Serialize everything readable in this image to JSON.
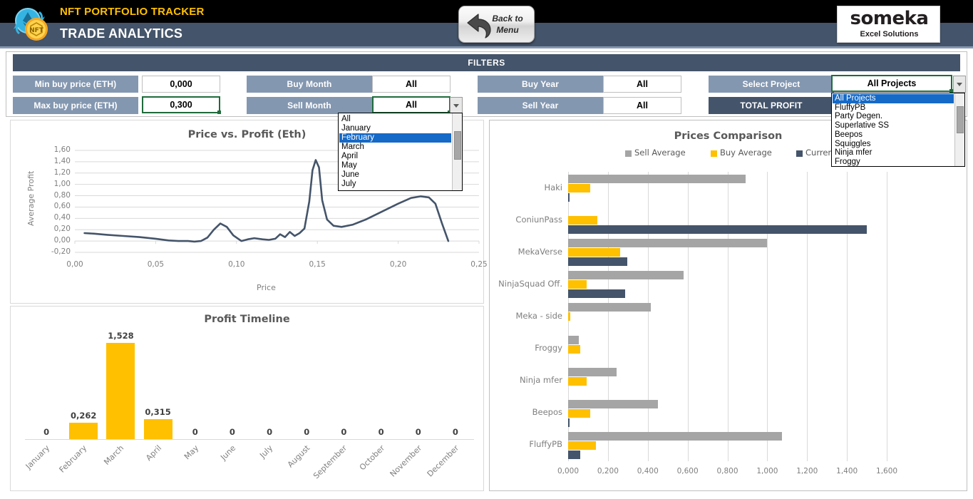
{
  "header": {
    "app_title": "NFT PORTFOLIO TRACKER",
    "page_title": "TRADE ANALYTICS",
    "back_button_line1": "Back to",
    "back_button_line2": "Menu",
    "brand_name": "someka",
    "brand_tagline": "Excel Solutions",
    "colors": {
      "top_bar": "#000000",
      "title_bar": "#44546a",
      "accent_yellow": "#ffc000"
    }
  },
  "filters": {
    "title": "FILTERS",
    "min_buy_price": {
      "label": "Min buy price (ETH)",
      "value": "0,000"
    },
    "max_buy_price": {
      "label": "Max buy price (ETH)",
      "value": "0,300"
    },
    "buy_month": {
      "label": "Buy Month",
      "value": "All"
    },
    "sell_month": {
      "label": "Sell Month",
      "value": "All"
    },
    "buy_year": {
      "label": "Buy Year",
      "value": "All"
    },
    "sell_year": {
      "label": "Sell Year",
      "value": "All"
    },
    "select_project": {
      "label": "Select Project",
      "value": "All Projects"
    },
    "total_profit": {
      "label": "TOTAL PROFIT"
    },
    "month_dropdown": {
      "open": true,
      "selected": "February",
      "options": [
        "All",
        "January",
        "February",
        "March",
        "April",
        "May",
        "June",
        "July"
      ]
    },
    "project_dropdown": {
      "open": true,
      "selected": "All Projects",
      "options": [
        "All Projects",
        "FluffyPB",
        "Party Degen.",
        "Superlative SS",
        "Beepos",
        "Squiggles",
        "Ninja mfer",
        "Froggy"
      ]
    }
  },
  "chart_data": [
    {
      "type": "line",
      "title": "Price vs. Profit (Eth)",
      "xlabel": "Price",
      "ylabel": "Average Profit",
      "xlim": [
        0.0,
        0.25
      ],
      "ylim": [
        -0.2,
        1.6
      ],
      "xticks": [
        "0,00",
        "0,05",
        "0,10",
        "0,15",
        "0,20",
        "0,25"
      ],
      "yticks": [
        "-0,20",
        "0,00",
        "0,20",
        "0,40",
        "0,60",
        "0,80",
        "1,00",
        "1,20",
        "1,40",
        "1,60"
      ],
      "grid": true,
      "legend": "none",
      "series": [
        {
          "name": "Average Profit",
          "color": "#44546a",
          "x": [
            0.006,
            0.012,
            0.02,
            0.03,
            0.04,
            0.05,
            0.058,
            0.064,
            0.07,
            0.074,
            0.078,
            0.082,
            0.086,
            0.09,
            0.094,
            0.098,
            0.103,
            0.107,
            0.111,
            0.116,
            0.12,
            0.124,
            0.127,
            0.13,
            0.133,
            0.136,
            0.139,
            0.142,
            0.145,
            0.147,
            0.149,
            0.151,
            0.153,
            0.156,
            0.16,
            0.165,
            0.172,
            0.18,
            0.19,
            0.2,
            0.208,
            0.214,
            0.219,
            0.223,
            0.227,
            0.231
          ],
          "y": [
            0.14,
            0.13,
            0.11,
            0.09,
            0.07,
            0.04,
            0.01,
            0.0,
            0.0,
            -0.01,
            0.0,
            0.06,
            0.2,
            0.31,
            0.25,
            0.1,
            0.0,
            0.03,
            0.05,
            0.03,
            0.02,
            0.04,
            0.12,
            0.07,
            0.16,
            0.09,
            0.14,
            0.22,
            0.7,
            1.25,
            1.43,
            1.3,
            0.72,
            0.38,
            0.27,
            0.25,
            0.29,
            0.38,
            0.52,
            0.66,
            0.76,
            0.79,
            0.77,
            0.66,
            0.32,
            0.0
          ]
        }
      ]
    },
    {
      "type": "bar",
      "title": "Profit Timeline",
      "categories": [
        "January",
        "February",
        "March",
        "April",
        "May",
        "June",
        "July",
        "August",
        "September",
        "October",
        "November",
        "December"
      ],
      "values": [
        0,
        0.262,
        1.528,
        0.315,
        0,
        0,
        0,
        0,
        0,
        0,
        0,
        0
      ],
      "data_labels": [
        "0",
        "0,262",
        "1,528",
        "0,315",
        "0",
        "0",
        "0",
        "0",
        "0",
        "0",
        "0",
        "0"
      ],
      "color": "#ffc000",
      "ylim": [
        0,
        1.7
      ],
      "grid": false
    },
    {
      "type": "bar",
      "orientation": "horizontal",
      "title": "Prices Comparison",
      "categories": [
        "Haki",
        "ConiunPass",
        "MekaVerse",
        "NinjaSquad Off.",
        "Meka - side",
        "Froggy",
        "Ninja mfer",
        "Beepos",
        "FluffyPB"
      ],
      "series": [
        {
          "name": "Sell Average",
          "color": "#a5a5a5",
          "values": [
            0.89,
            0.0,
            1.0,
            0.58,
            0.415,
            0.055,
            0.245,
            0.45,
            1.075
          ]
        },
        {
          "name": "Buy Average",
          "color": "#ffc000",
          "values": [
            0.112,
            0.148,
            0.262,
            0.092,
            0.012,
            0.062,
            0.092,
            0.112,
            0.14
          ]
        },
        {
          "name": "Current Floor",
          "color": "#44546a",
          "values": [
            0.005,
            1.5,
            0.298,
            0.285,
            0.0,
            0.0,
            0.0,
            0.005,
            0.06
          ]
        }
      ],
      "xlim": [
        0,
        1.7
      ],
      "xticks": [
        "0,000",
        "0,200",
        "0,400",
        "0,600",
        "0,800",
        "1,000",
        "1,200",
        "1,400",
        "1,600"
      ],
      "legend": [
        "Sell Average",
        "Buy Average",
        "Current Floor"
      ],
      "legend_position": "top",
      "grid": true
    }
  ]
}
